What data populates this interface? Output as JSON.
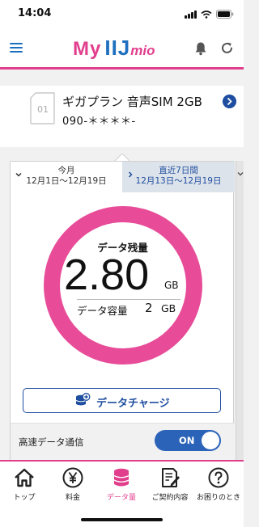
{
  "status_bar": {
    "time": "14:04"
  },
  "header": {
    "logo_my": "My",
    "logo_iij": "IIJ",
    "logo_mio": "mio",
    "icons": [
      "menu-icon",
      "bell-icon",
      "refresh-icon"
    ]
  },
  "sim": {
    "slot_number": "01",
    "plan_name": "ギガプラン 音声SIM 2GB",
    "phone_number": "090-＊＊＊＊-"
  },
  "tabs": {
    "current": {
      "line1": "今月",
      "line2": "12月1日〜12月19日"
    },
    "week": {
      "line1": "直近7日間",
      "line2": "12月13日〜12月19日"
    }
  },
  "usage": {
    "remaining_label": "データ残量",
    "remaining_value": "2.80",
    "remaining_unit": "GB",
    "capacity_label": "データ容量",
    "capacity_value": "2",
    "capacity_unit": "GB",
    "remaining_fraction": 1.0
  },
  "charge_button": {
    "label": "データチャージ"
  },
  "high_speed": {
    "label": "高速データ通信",
    "toggle_label": "ON",
    "enabled": true
  },
  "bottom_nav": [
    {
      "label": "トップ",
      "icon": "home-icon",
      "active": false
    },
    {
      "label": "料金",
      "icon": "yen-icon",
      "active": false
    },
    {
      "label": "データ量",
      "icon": "database-icon",
      "active": true
    },
    {
      "label": "ご契約内容",
      "icon": "contract-icon",
      "active": false
    },
    {
      "label": "お困りのとき",
      "icon": "help-icon",
      "active": false
    }
  ],
  "colors": {
    "accent_pink": "#e13f8d",
    "brand_blue": "#1f4ea0",
    "toggle_blue": "#2b63b8"
  }
}
